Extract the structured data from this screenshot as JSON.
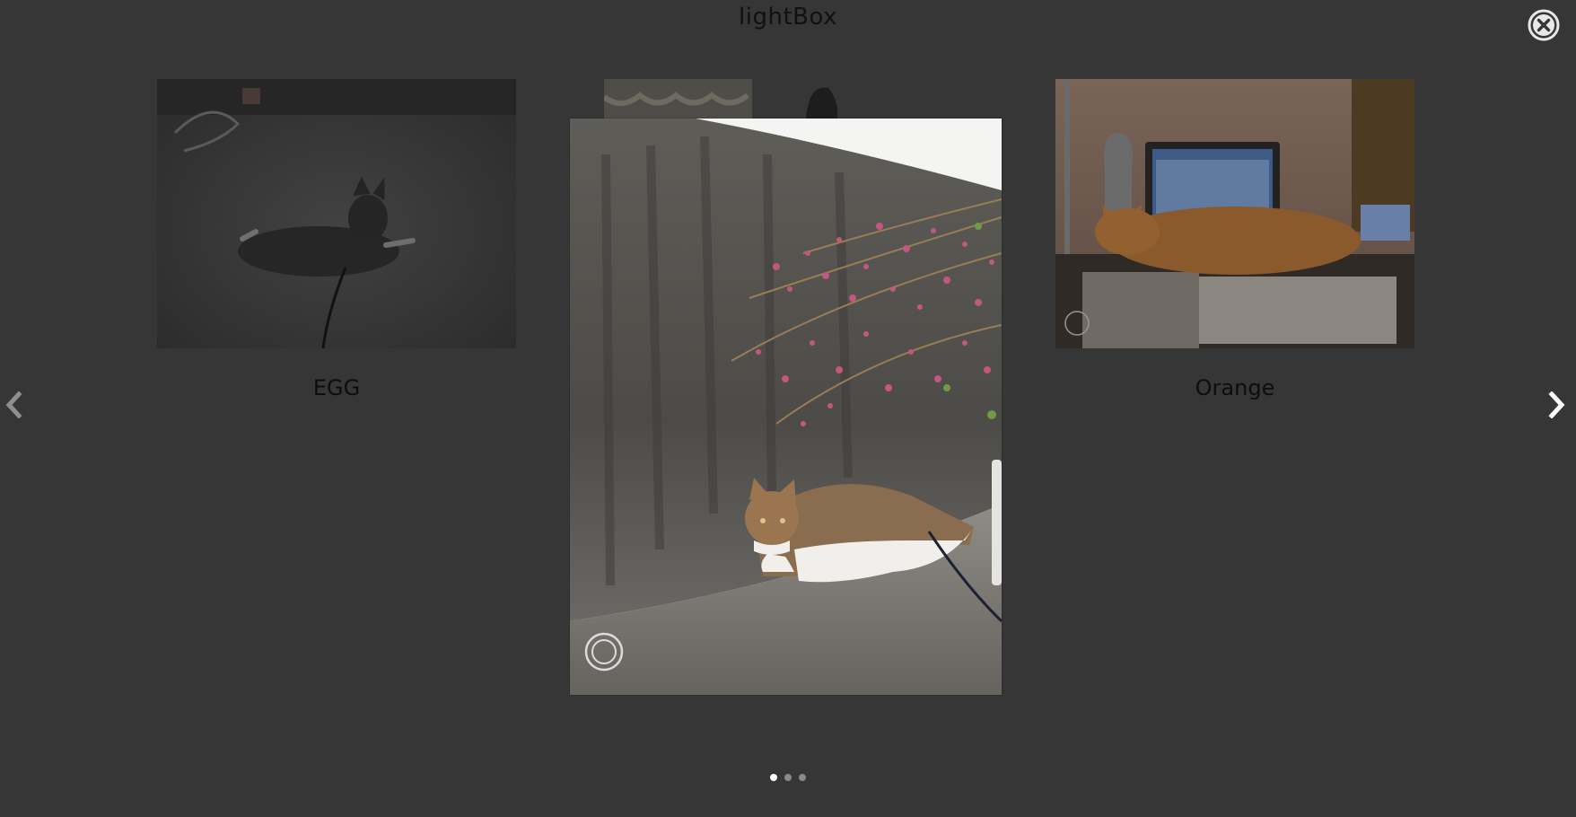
{
  "header": {
    "title": "lightBox"
  },
  "controls": {
    "close_icon": "close-circle-icon",
    "prev_icon": "chevron-left-icon",
    "next_icon": "chevron-right-icon"
  },
  "slides": [
    {
      "caption": "EGG",
      "image": "cat-lying-on-concrete-dim"
    },
    {
      "caption": "",
      "image": "cat-lying-by-wall-with-pink-flowers"
    },
    {
      "caption": "Orange",
      "image": "orange-cat-on-desk-by-laptop"
    }
  ],
  "pagination": {
    "count": 3,
    "active_index": 0
  },
  "colors": {
    "background": "#363636",
    "dot_active": "#ffffff",
    "dot_inactive": "#8a8a8a",
    "arrow_prev": "#8f8f8f",
    "arrow_next": "#ffffff"
  }
}
